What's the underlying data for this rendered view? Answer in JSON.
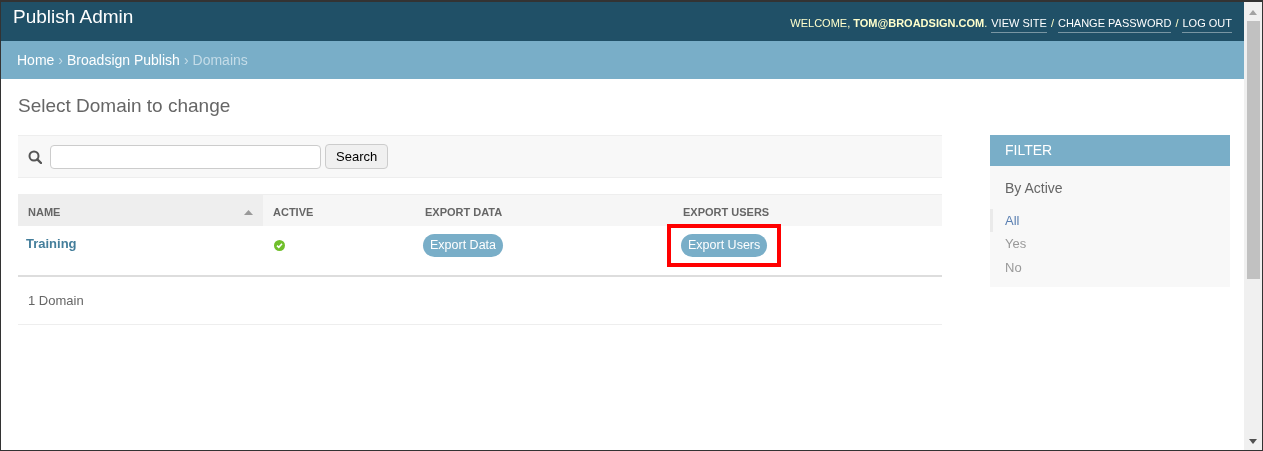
{
  "header": {
    "title": "Publish Admin",
    "user_tools": [
      {
        "kind": "text",
        "text": "WELCOME, **TOM@BROADSIGN.COM**."
      },
      {
        "kind": "link",
        "text": "VIEW SITE"
      },
      {
        "kind": "text",
        "text": "/"
      },
      {
        "kind": "link",
        "text": "CHANGE PASSWORD"
      },
      {
        "kind": "text",
        "text": "/"
      },
      {
        "kind": "link",
        "text": "LOG OUT"
      }
    ]
  },
  "breadcrumbs": [
    {
      "kind": "link",
      "text": "Home"
    },
    {
      "kind": "sep",
      "text": "›"
    },
    {
      "kind": "link",
      "text": "Broadsign Publish"
    },
    {
      "kind": "sep",
      "text": "›"
    },
    {
      "kind": "current",
      "text": "Domains"
    }
  ],
  "page_title": "Select Domain to change",
  "search": {
    "button": "Search"
  },
  "table": {
    "columns": [
      {
        "label": "NAME",
        "sorted": true
      },
      {
        "label": "ACTIVE",
        "sorted": false
      },
      {
        "label": "EXPORT DATA",
        "sorted": false
      },
      {
        "label": "EXPORT USERS",
        "sorted": false
      }
    ],
    "rows": [
      {
        "cells": [
          {
            "kind": "link",
            "text": "Training"
          },
          {
            "kind": "status",
            "on": true
          },
          {
            "kind": "button",
            "text": "Export Data",
            "highlighted": false
          },
          {
            "kind": "button",
            "text": "Export Users",
            "highlighted": true
          }
        ]
      }
    ]
  },
  "paginator": "1 Domain",
  "filter": {
    "title": "FILTER",
    "section": "By Active",
    "options": [
      {
        "label": "All",
        "selected": true
      },
      {
        "label": "Yes",
        "selected": false
      },
      {
        "label": "No",
        "selected": false
      }
    ]
  }
}
